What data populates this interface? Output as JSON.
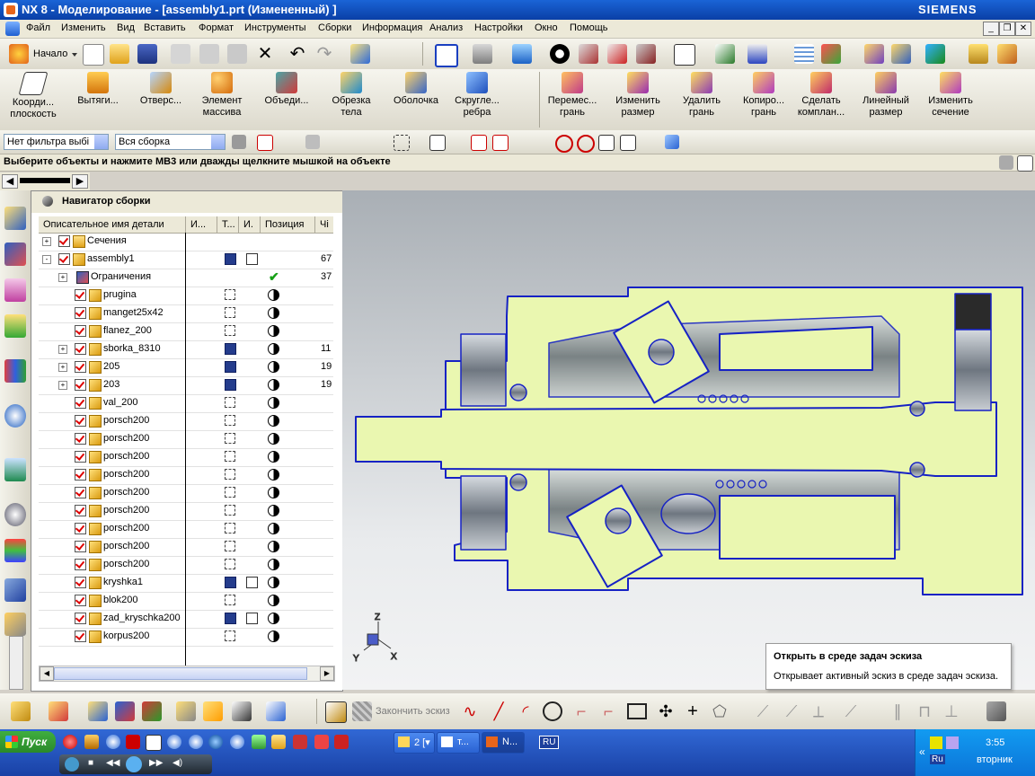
{
  "window": {
    "title": "NX 8 - Моделирование - [assembly1.prt (Измененный) ]",
    "brand": "SIEMENS"
  },
  "menu": [
    "Файл",
    "Изменить",
    "Вид",
    "Вставить",
    "Формат",
    "Инструменты",
    "Сборки",
    "Информация",
    "Анализ",
    "Настройки",
    "Окно",
    "Помощь"
  ],
  "standard_toolbar": {
    "start_label": "Начало"
  },
  "feature_toolbar": {
    "buttons": [
      {
        "line1": "Коорди...",
        "line2": "плоскость"
      },
      {
        "line1": "Вытяги...",
        "line2": ""
      },
      {
        "line1": "Отверс...",
        "line2": ""
      },
      {
        "line1": "Элемент",
        "line2": "массива"
      },
      {
        "line1": "Объеди...",
        "line2": ""
      },
      {
        "line1": "Обрезка",
        "line2": "тела"
      },
      {
        "line1": "Оболочка",
        "line2": ""
      },
      {
        "line1": "Скругле...",
        "line2": "ребра"
      },
      {
        "line1": "Перемес...",
        "line2": "грань"
      },
      {
        "line1": "Изменить",
        "line2": "размер"
      },
      {
        "line1": "Удалить",
        "line2": "грань"
      },
      {
        "line1": "Копиро...",
        "line2": "грань"
      },
      {
        "line1": "Сделать",
        "line2": "комплан..."
      },
      {
        "line1": "Линейный",
        "line2": "размер"
      },
      {
        "line1": "Изменить",
        "line2": "сечение"
      }
    ]
  },
  "selection_bar": {
    "filter": "Нет фильтра выбі",
    "scope": "Вся сборка"
  },
  "status": {
    "message": "Выберите объекты и нажмите MB3 или дважды щелкните мышкой на объекте"
  },
  "navigator": {
    "title": "Навигатор сборки",
    "columns": [
      "Описательное имя детали",
      "И...",
      "Т...",
      "И.",
      "Позиция",
      "Чі"
    ],
    "rows": [
      {
        "name": "Сечения",
        "level": 0,
        "expand": "+",
        "icon": "folder",
        "save": "",
        "edit": false,
        "pos": "",
        "num": ""
      },
      {
        "name": "assembly1",
        "level": 0,
        "expand": "-",
        "icon": "assembly",
        "save": "saved",
        "edit": true,
        "pos": "",
        "num": "67"
      },
      {
        "name": "Ограничения",
        "level": 1,
        "expand": "+",
        "icon": "constraints",
        "save": "",
        "edit": false,
        "pos": "tick",
        "num": "37"
      },
      {
        "name": "prugina",
        "level": 1,
        "expand": "",
        "icon": "part",
        "save": "dash",
        "edit": false,
        "pos": "half",
        "num": ""
      },
      {
        "name": "manget25x42",
        "level": 1,
        "expand": "",
        "icon": "part",
        "save": "dash",
        "edit": false,
        "pos": "half",
        "num": ""
      },
      {
        "name": "flanez_200",
        "level": 1,
        "expand": "",
        "icon": "part",
        "save": "dash",
        "edit": false,
        "pos": "half",
        "num": ""
      },
      {
        "name": "sborka_8310",
        "level": 1,
        "expand": "+",
        "icon": "assembly",
        "save": "saved",
        "edit": false,
        "pos": "half",
        "num": "11"
      },
      {
        "name": "205",
        "level": 1,
        "expand": "+",
        "icon": "assembly",
        "save": "saved",
        "edit": false,
        "pos": "half",
        "num": "19"
      },
      {
        "name": "203",
        "level": 1,
        "expand": "+",
        "icon": "assembly",
        "save": "saved",
        "edit": false,
        "pos": "half",
        "num": "19"
      },
      {
        "name": "val_200",
        "level": 1,
        "expand": "",
        "icon": "part",
        "save": "dash",
        "edit": false,
        "pos": "half",
        "num": ""
      },
      {
        "name": "porsch200",
        "level": 1,
        "expand": "",
        "icon": "part",
        "save": "dash",
        "edit": false,
        "pos": "half",
        "num": ""
      },
      {
        "name": "porsch200",
        "level": 1,
        "expand": "",
        "icon": "part",
        "save": "dash",
        "edit": false,
        "pos": "half",
        "num": ""
      },
      {
        "name": "porsch200",
        "level": 1,
        "expand": "",
        "icon": "part",
        "save": "dash",
        "edit": false,
        "pos": "half",
        "num": ""
      },
      {
        "name": "porsch200",
        "level": 1,
        "expand": "",
        "icon": "part",
        "save": "dash",
        "edit": false,
        "pos": "half",
        "num": ""
      },
      {
        "name": "porsch200",
        "level": 1,
        "expand": "",
        "icon": "part",
        "save": "dash",
        "edit": false,
        "pos": "half",
        "num": ""
      },
      {
        "name": "porsch200",
        "level": 1,
        "expand": "",
        "icon": "part",
        "save": "dash",
        "edit": false,
        "pos": "half",
        "num": ""
      },
      {
        "name": "porsch200",
        "level": 1,
        "expand": "",
        "icon": "part",
        "save": "dash",
        "edit": false,
        "pos": "half",
        "num": ""
      },
      {
        "name": "porsch200",
        "level": 1,
        "expand": "",
        "icon": "part",
        "save": "dash",
        "edit": false,
        "pos": "half",
        "num": ""
      },
      {
        "name": "porsch200",
        "level": 1,
        "expand": "",
        "icon": "part",
        "save": "dash",
        "edit": false,
        "pos": "half",
        "num": ""
      },
      {
        "name": "kryshka1",
        "level": 1,
        "expand": "",
        "icon": "part",
        "save": "saved",
        "edit": true,
        "pos": "half",
        "num": ""
      },
      {
        "name": "blok200",
        "level": 1,
        "expand": "",
        "icon": "part",
        "save": "dash",
        "edit": false,
        "pos": "half",
        "num": ""
      },
      {
        "name": "zad_kryschka200",
        "level": 1,
        "expand": "",
        "icon": "part",
        "save": "saved",
        "edit": true,
        "pos": "half",
        "num": ""
      },
      {
        "name": "korpus200",
        "level": 1,
        "expand": "",
        "icon": "part",
        "save": "dash",
        "edit": false,
        "pos": "half",
        "num": ""
      }
    ]
  },
  "viewport": {
    "triad_labels": {
      "z": "Z",
      "y": "Y",
      "x": "X"
    },
    "section_fill": "#eaf7b0",
    "outline_color": "#1622c4"
  },
  "tooltip": {
    "title": "Открыть в среде задач эскиза",
    "description": "Открывает активный эскиз в среде задач эскиза."
  },
  "sketch_toolbar": {
    "finish_label": "Закончить эскиз"
  },
  "taskbar": {
    "start": "Пуск",
    "tasks": [
      "2 [▾",
      "т...",
      "N..."
    ],
    "lang": "RU",
    "lang2": "Ru",
    "clock": "3:55",
    "day": "вторник"
  }
}
